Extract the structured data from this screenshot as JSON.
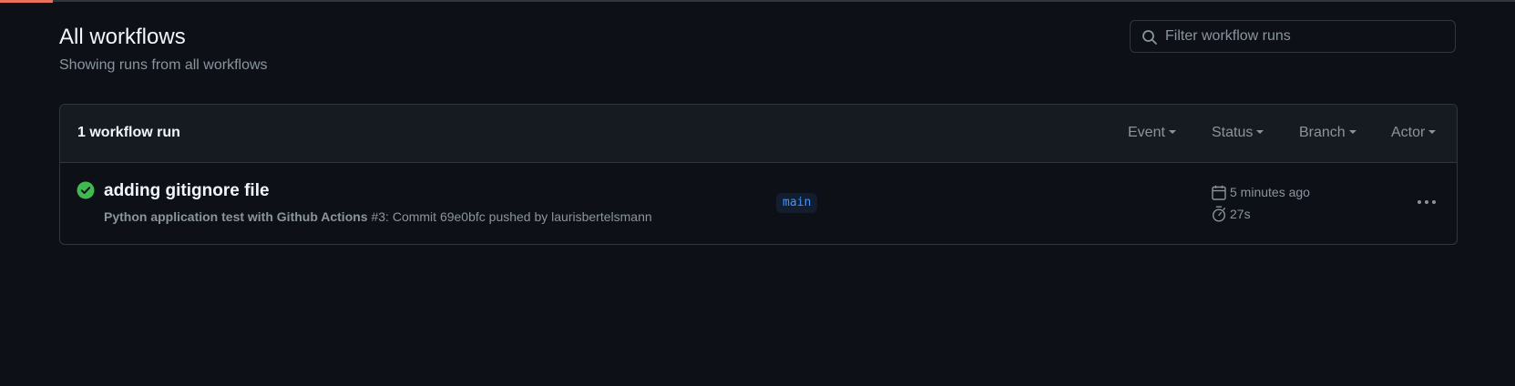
{
  "page": {
    "title": "All workflows",
    "subtitle": "Showing runs from all workflows"
  },
  "search": {
    "placeholder": "Filter workflow runs",
    "value": ""
  },
  "runs_header": {
    "count_label": "1 workflow run",
    "filters": {
      "event": "Event",
      "status": "Status",
      "branch": "Branch",
      "actor": "Actor"
    }
  },
  "runs": [
    {
      "title": "adding gitignore file",
      "status": "success",
      "status_icon": "check-circle-fill-icon",
      "workflow_name": "Python application test with Github Actions",
      "details": " #3: Commit 69e0bfc pushed by laurisbertelsmann",
      "branch": "main",
      "time_ago": "5 minutes ago",
      "duration": "27s"
    }
  ],
  "colors": {
    "background": "#0d1117",
    "header_background": "#161b22",
    "border": "#30363d",
    "success": "#3fb950",
    "branch_text": "#4493f8",
    "progress_accent": "#e8735a"
  }
}
